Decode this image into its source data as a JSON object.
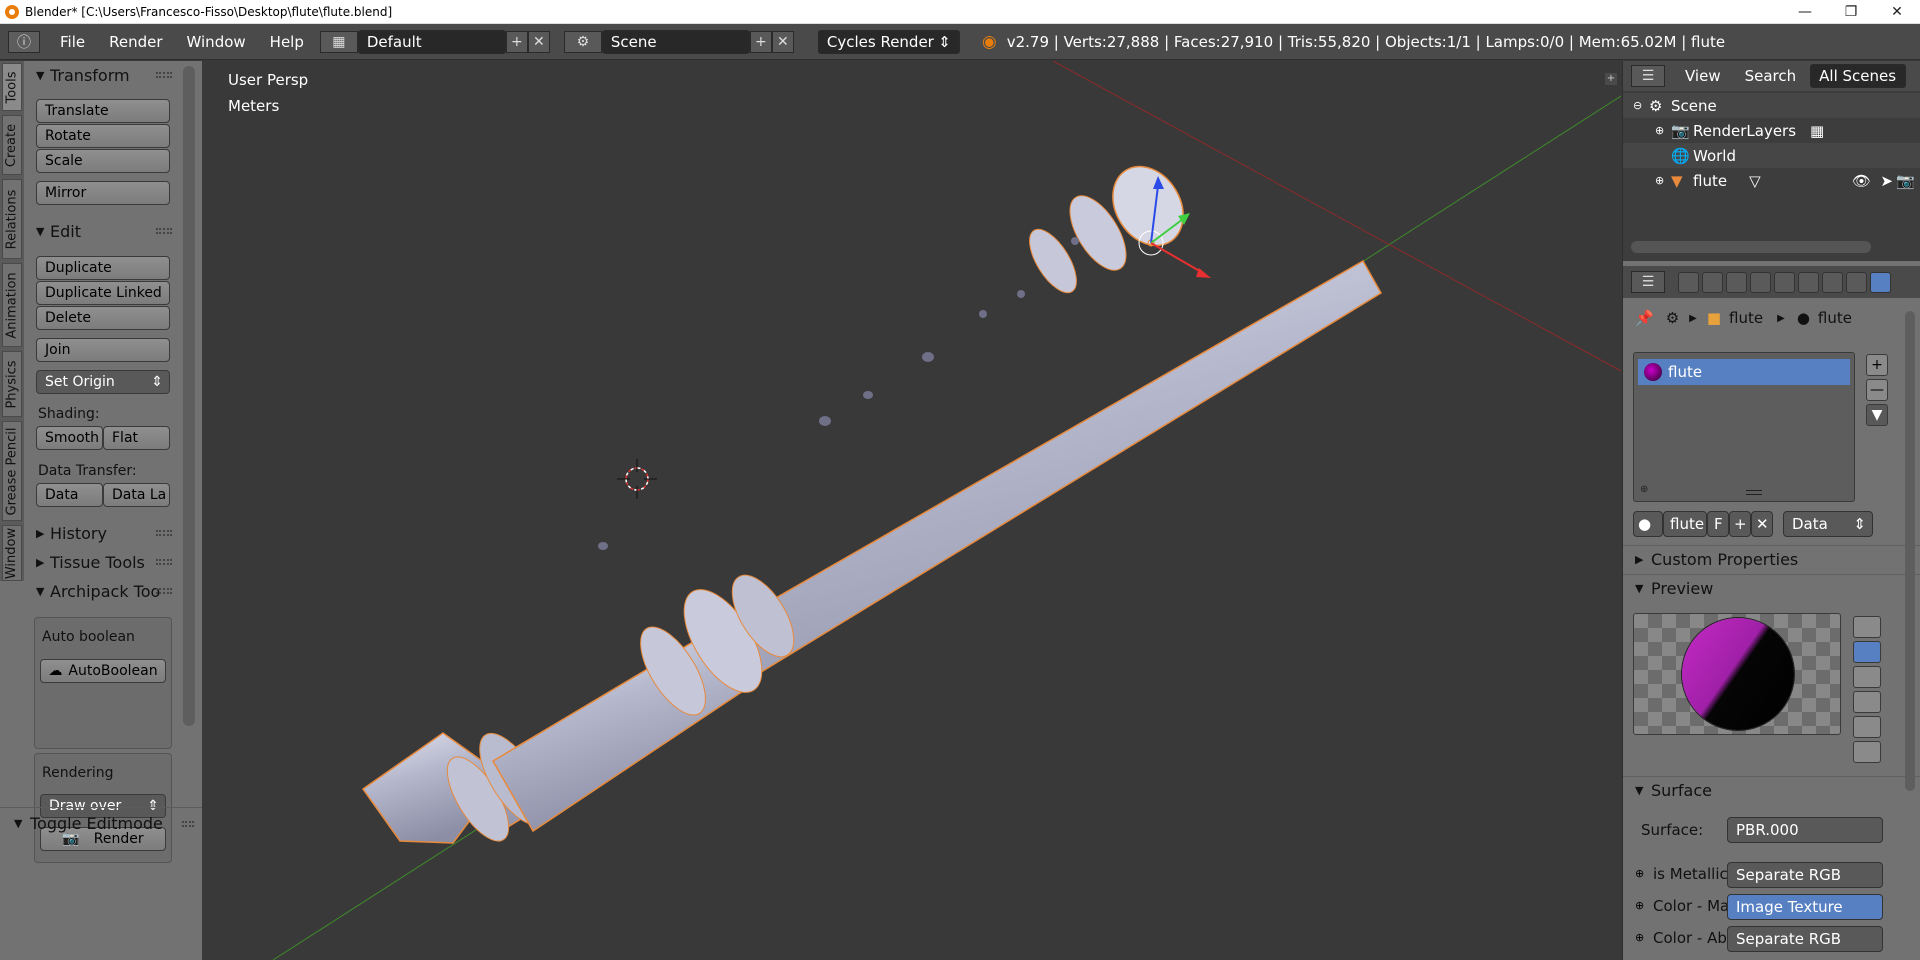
{
  "window": {
    "title": "Blender* [C:\\Users\\Francesco-Fisso\\Desktop\\flute\\flute.blend]"
  },
  "topbar": {
    "menus": [
      "File",
      "Render",
      "Window",
      "Help"
    ],
    "layout": "Default",
    "scene": "Scene",
    "engine": "Cycles Render",
    "stats": "v2.79 | Verts:27,888 | Faces:27,910 | Tris:55,820 | Objects:1/1 | Lamps:0/0 | Mem:65.02M | flute"
  },
  "left_tabs": [
    "Tools",
    "Create",
    "Relations",
    "Animation",
    "Physics",
    "Grease Pencil",
    "Window"
  ],
  "tools": {
    "transform_header": "Transform",
    "translate": "Translate",
    "rotate": "Rotate",
    "scale": "Scale",
    "mirror": "Mirror",
    "edit_header": "Edit",
    "duplicate": "Duplicate",
    "duplicate_linked": "Duplicate Linked",
    "delete": "Delete",
    "join": "Join",
    "set_origin": "Set Origin",
    "shading_label": "Shading:",
    "smooth": "Smooth",
    "flat": "Flat",
    "data_transfer_label": "Data Transfer:",
    "data": "Data",
    "data_la": "Data La",
    "history": "History",
    "tissue": "Tissue Tools",
    "archipack": "Archipack Too",
    "auto_boolean_label": "Auto boolean",
    "auto_boolean_btn": "AutoBoolean",
    "rendering_label": "Rendering",
    "draw_over": "Draw over",
    "render_btn": "Render",
    "toggle_editmode": "Toggle Editmode"
  },
  "viewport": {
    "view_name": "User Persp",
    "units": "Meters"
  },
  "outliner": {
    "view": "View",
    "search": "Search",
    "filter": "All Scenes",
    "scene": "Scene",
    "renderlayers": "RenderLayers",
    "world": "World",
    "object": "flute"
  },
  "properties": {
    "breadcrumb_obj": "flute",
    "breadcrumb_mat": "flute",
    "material_slot": "flute",
    "material_name": "flute",
    "f_label": "F",
    "link": "Data",
    "custom_props": "Custom Properties",
    "preview": "Preview",
    "surface_header": "Surface",
    "surface_label": "Surface:",
    "surface_value": "PBR.000",
    "inputs": [
      {
        "label": "is Metallic",
        "value": "Separate RGB"
      },
      {
        "label": "Color - Ma",
        "value": "Image Texture"
      },
      {
        "label": "Color - Ab",
        "value": "Separate RGB"
      }
    ]
  },
  "colors": {
    "accent": "#5680c2",
    "header": "#4a4a4a",
    "panel": "#727272",
    "viewport": "#393939",
    "mesh": "#b9bbd0",
    "outline": "#e88a3c"
  }
}
